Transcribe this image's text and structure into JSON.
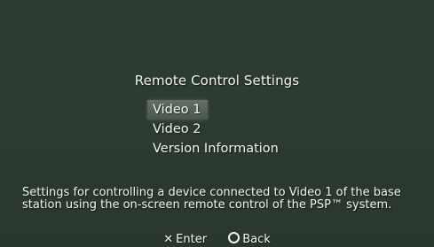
{
  "screen": {
    "title": "Remote Control Settings",
    "menu": {
      "items": [
        {
          "label": "Video 1",
          "selected": true
        },
        {
          "label": "Video 2",
          "selected": false
        },
        {
          "label": "Version Information",
          "selected": false
        }
      ]
    },
    "description": "Settings for controlling a device connected to Video 1 of the base station using the on-screen remote control of the PSP™ system.",
    "controls": {
      "enter_glyph": "✕",
      "enter_label": "Enter",
      "back_label": "Back"
    }
  },
  "colors": {
    "background": "#2b3a31",
    "text": "#f2f4f2"
  },
  "icons": {
    "enter": "cross-button-icon",
    "back": "circle-button-icon"
  }
}
